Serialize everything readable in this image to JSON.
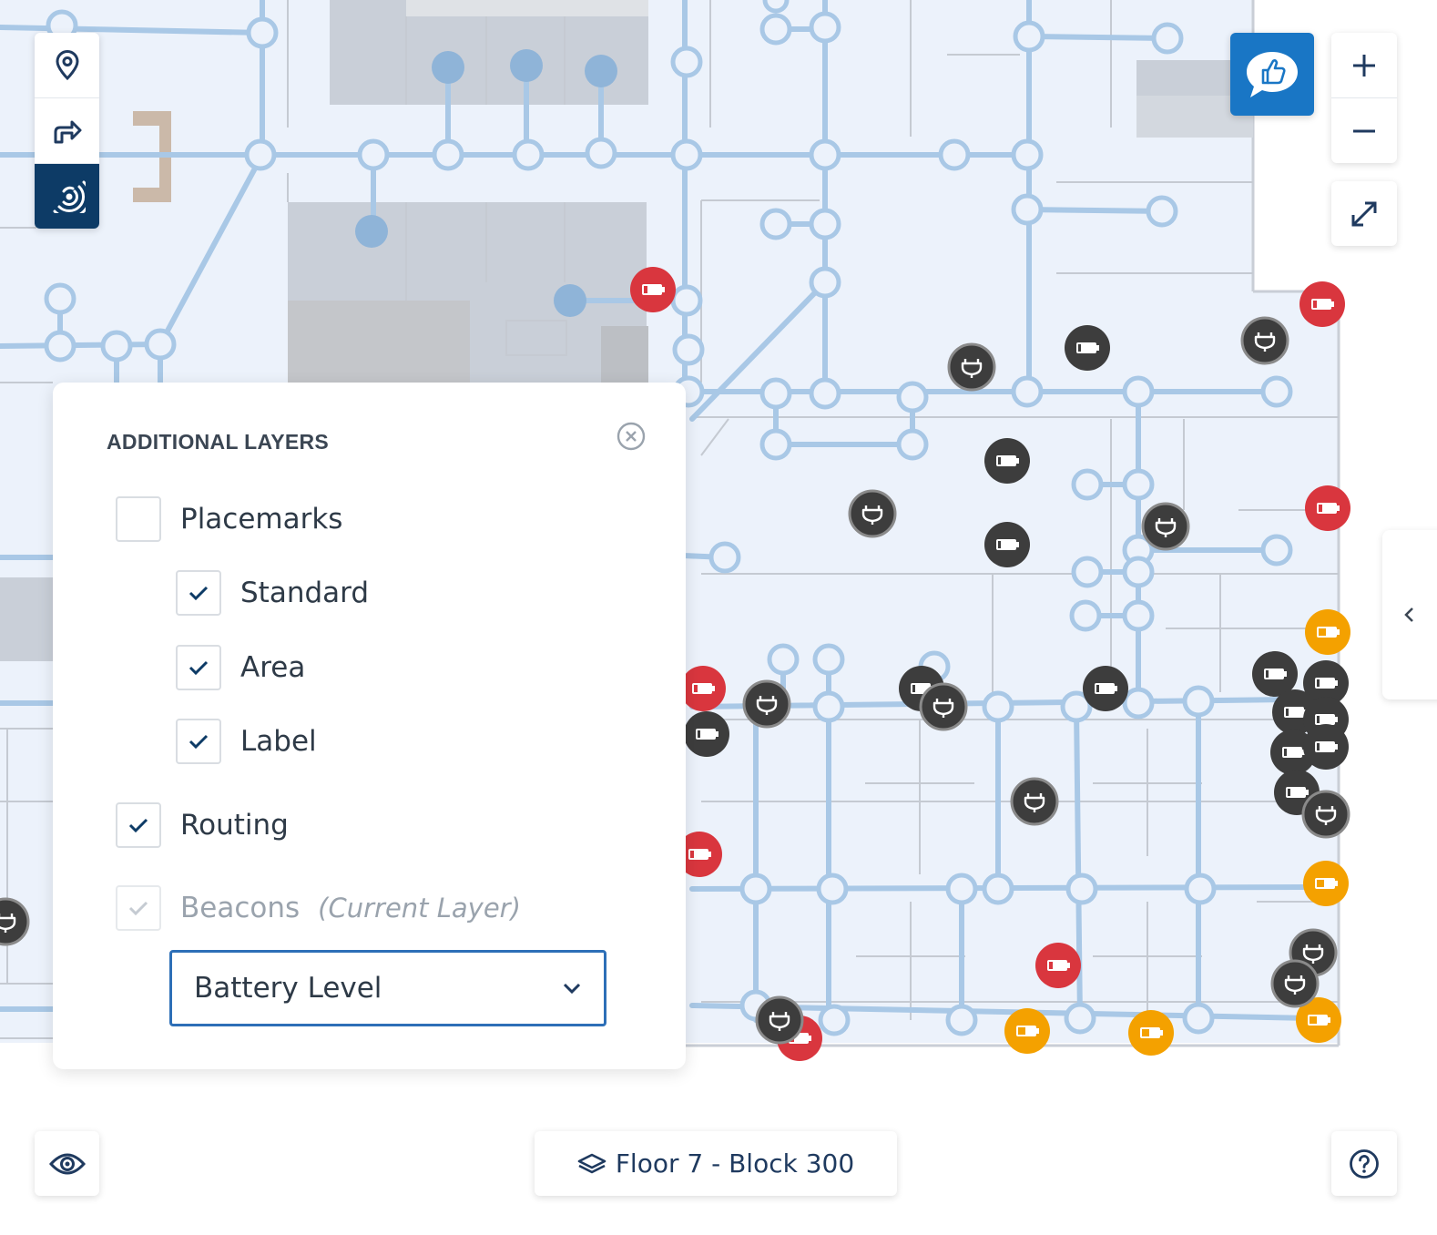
{
  "toolbar": {
    "tools": [
      {
        "icon": "location-pin-icon",
        "active": false
      },
      {
        "icon": "route-arrow-icon",
        "active": false
      },
      {
        "icon": "beacon-signal-icon",
        "active": true
      }
    ]
  },
  "zoom": {
    "in_icon": "plus-icon",
    "out_icon": "minus-icon",
    "fullscreen_icon": "expand-icon"
  },
  "feedback": {
    "icon": "thumbs-up-icon"
  },
  "layers_panel": {
    "title": "ADDITIONAL LAYERS",
    "close_icon": "close-circle-icon",
    "items": [
      {
        "label": "Placemarks",
        "checked": false,
        "indent": 0
      },
      {
        "label": "Standard",
        "checked": true,
        "indent": 1
      },
      {
        "label": "Area",
        "checked": true,
        "indent": 1
      },
      {
        "label": "Label",
        "checked": true,
        "indent": 1
      },
      {
        "label": "Routing",
        "checked": true,
        "indent": 0
      },
      {
        "label": "Beacons",
        "note": "(Current Layer)",
        "checked": true,
        "disabled": true,
        "indent": 0
      }
    ],
    "beacon_view": {
      "selected": "Battery Level"
    }
  },
  "floor_selector": {
    "icon": "layers-icon",
    "label": "Floor 7 - Block 300"
  },
  "bottom_left": {
    "icon": "eye-icon"
  },
  "bottom_right": {
    "icon": "help-icon"
  },
  "side_toggle": {
    "icon": "chevron-left-icon"
  },
  "colors": {
    "accent": "#1976c5",
    "dark_active": "#0d3b66",
    "route": "#a9c8e6",
    "battery_low": "#d9363e",
    "battery_medium": "#f4a100",
    "beacon_neutral": "#3d3d3d"
  },
  "map": {
    "beacon_markers": [
      {
        "type": "battery",
        "status": "low"
      },
      {
        "type": "battery",
        "status": "low"
      },
      {
        "type": "battery",
        "status": "low"
      },
      {
        "type": "battery",
        "status": "low"
      },
      {
        "type": "battery",
        "status": "low"
      },
      {
        "type": "battery",
        "status": "low"
      },
      {
        "type": "battery",
        "status": "low"
      },
      {
        "type": "battery",
        "status": "medium"
      },
      {
        "type": "battery",
        "status": "medium"
      },
      {
        "type": "battery",
        "status": "medium"
      },
      {
        "type": "battery",
        "status": "medium"
      },
      {
        "type": "battery",
        "status": "medium"
      },
      {
        "type": "battery",
        "status": "unknown"
      },
      {
        "type": "battery",
        "status": "unknown"
      },
      {
        "type": "battery",
        "status": "unknown"
      },
      {
        "type": "battery",
        "status": "unknown"
      },
      {
        "type": "battery",
        "status": "unknown"
      },
      {
        "type": "battery",
        "status": "unknown"
      },
      {
        "type": "battery",
        "status": "unknown"
      },
      {
        "type": "battery",
        "status": "unknown"
      },
      {
        "type": "battery",
        "status": "unknown"
      },
      {
        "type": "battery",
        "status": "unknown"
      },
      {
        "type": "battery",
        "status": "unknown"
      },
      {
        "type": "battery",
        "status": "unknown"
      },
      {
        "type": "battery",
        "status": "unknown"
      },
      {
        "type": "power",
        "status": "neutral"
      },
      {
        "type": "power",
        "status": "neutral"
      },
      {
        "type": "power",
        "status": "neutral"
      },
      {
        "type": "power",
        "status": "neutral"
      },
      {
        "type": "power",
        "status": "neutral"
      },
      {
        "type": "power",
        "status": "neutral"
      },
      {
        "type": "power",
        "status": "neutral"
      },
      {
        "type": "power",
        "status": "neutral"
      },
      {
        "type": "power",
        "status": "neutral"
      },
      {
        "type": "power",
        "status": "neutral"
      },
      {
        "type": "power",
        "status": "neutral"
      },
      {
        "type": "power",
        "status": "neutral"
      }
    ]
  }
}
